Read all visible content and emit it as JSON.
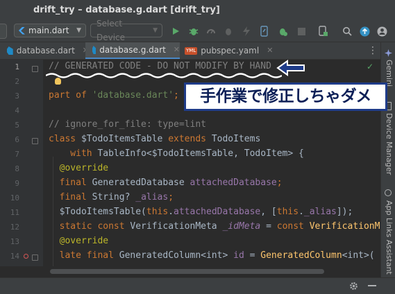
{
  "window": {
    "title": "drift_try – database.g.dart [drift_try]"
  },
  "toolbar": {
    "run_config": "main.dart",
    "device_selector": "Select Device"
  },
  "tabs": [
    {
      "label": "database.dart",
      "icon": "dart-file-icon",
      "active": false
    },
    {
      "label": "database.g.dart",
      "icon": "dart-file-icon",
      "active": true
    },
    {
      "label": "pubspec.yaml",
      "icon": "yaml-file-icon",
      "active": false
    }
  ],
  "right_strip": {
    "items": [
      "Gemini",
      "Device Manager",
      "App Links Assistant"
    ]
  },
  "editor": {
    "line_numbers": [
      "1",
      "2",
      "3",
      "4",
      "5",
      "6",
      "7",
      "8",
      "9",
      "10",
      "11",
      "12",
      "13",
      "14"
    ],
    "lines": {
      "l1": "// GENERATED CODE - DO NOT MODIFY BY HAND",
      "l3_kw": "part of ",
      "l3_str": "'database.dart'",
      "l3_end": ";",
      "l5": "// ignore_for_file: type=lint",
      "l6_kw": "class ",
      "l6_name": "$TodoItemsTable ",
      "l6_kw2": "extends ",
      "l6_rest": "TodoItems",
      "l7_kw": "    with ",
      "l7_rest": "TableInfo<$TodoItemsTable, TodoItem> {",
      "l8": "  @override",
      "l9_kw": "  final ",
      "l9_type": "GeneratedDatabase ",
      "l9_fld": "attachedDatabase",
      "l9_end": ";",
      "l10_kw": "  final ",
      "l10_type": "String? ",
      "l10_fld": "_alias",
      "l10_end": ";",
      "l11_a": "  $TodoItemsTable(",
      "l11_kw": "this",
      "l11_b": ".",
      "l11_fld": "attachedDatabase",
      "l11_c": ", [",
      "l11_kw2": "this",
      "l11_d": ".",
      "l11_fld2": "_alias",
      "l11_e": "]);",
      "l12_kw": "  static const ",
      "l12_type": "VerificationMeta ",
      "l12_fld": "_idMeta",
      "l12_eq": " = ",
      "l12_kw2": "const ",
      "l12_fn": "VerificationM",
      "l13": "  @override",
      "l14_kw": "  late final ",
      "l14_type": "GeneratedColumn<int> ",
      "l14_name": "id",
      "l14_eq": " = ",
      "l14_fn": "GeneratedColumn",
      "l14_end": "<int>("
    }
  },
  "annotation": {
    "callout_text": "手作業で修正しちゃダメ"
  },
  "colors": {
    "callout_border": "#1f3c89",
    "arrow": "#1f3c89",
    "wave_underline": "#ffffff"
  }
}
